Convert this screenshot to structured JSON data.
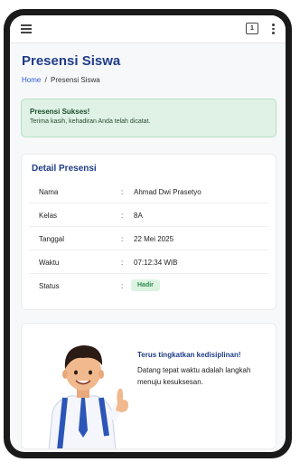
{
  "header": {
    "menu_icon": "hamburger-menu-icon",
    "tabs_count": "1",
    "more_icon": "kebab-menu-icon"
  },
  "page": {
    "title": "Presensi Siswa"
  },
  "breadcrumb": {
    "home": "Home",
    "separator": "/",
    "current": "Presensi Siswa"
  },
  "alert": {
    "title": "Presensi Sukses!",
    "message": "Terima kasih, kehadiran Anda telah dicatat."
  },
  "detail": {
    "title": "Detail Presensi",
    "rows": [
      {
        "label": "Nama",
        "value": "Ahmad Dwi Prasetyo"
      },
      {
        "label": "Kelas",
        "value": "8A"
      },
      {
        "label": "Tanggal",
        "value": "22 Mei 2025"
      },
      {
        "label": "Waktu",
        "value": "07:12:34 WIB"
      },
      {
        "label": "Status",
        "value": "Hadir"
      }
    ],
    "colon": ":"
  },
  "motivation": {
    "title": "Terus tingkatkan kedisiplinan!",
    "text": "Datang tepat waktu adalah langkah menuju kesuksesan."
  },
  "colors": {
    "primary": "#1f3c88",
    "link": "#2a5bd7",
    "success_bg": "#dff2e5",
    "badge_bg": "#dcf3e2",
    "badge_text": "#2e8b4a"
  }
}
